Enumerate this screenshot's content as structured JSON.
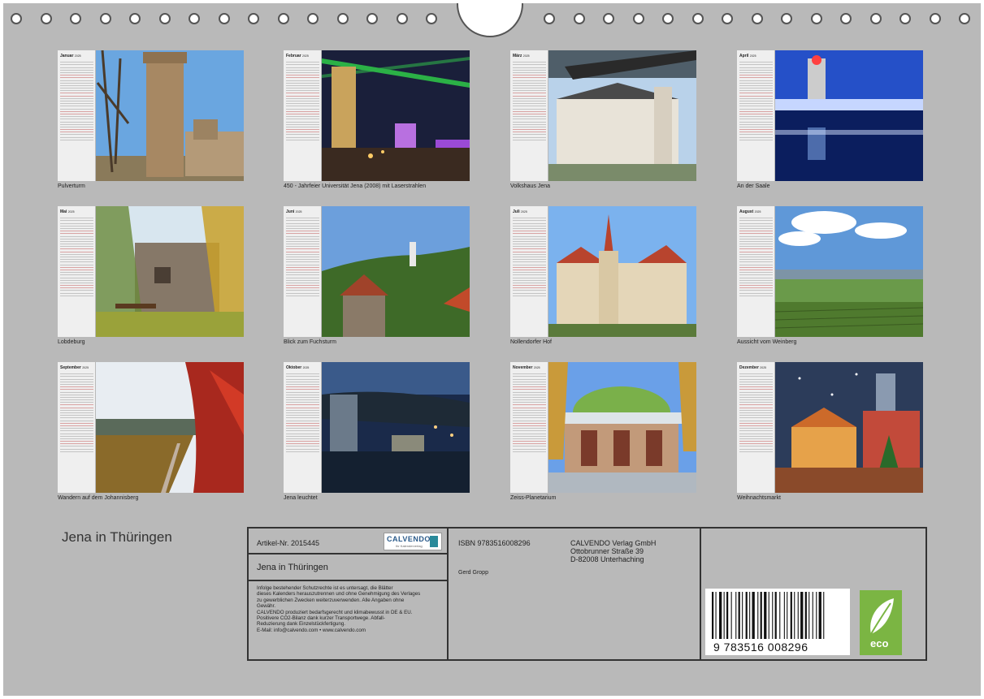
{
  "year": "2025",
  "months": [
    {
      "name": "Januar",
      "caption": "Pulverturm"
    },
    {
      "name": "Februar",
      "caption": "450 - Jahrfeier Universität Jena (2008) mit Laserstrahlen"
    },
    {
      "name": "März",
      "caption": "Volkshaus Jena"
    },
    {
      "name": "April",
      "caption": "An der Saale"
    },
    {
      "name": "Mai",
      "caption": "Lobdeburg"
    },
    {
      "name": "Juni",
      "caption": "Blick zum Fuchsturm"
    },
    {
      "name": "Juli",
      "caption": "Nollendorfer Hof"
    },
    {
      "name": "August",
      "caption": "Aussicht vom Weinberg"
    },
    {
      "name": "September",
      "caption": "Wandern auf dem Johannisberg"
    },
    {
      "name": "Oktober",
      "caption": "Jena leuchtet"
    },
    {
      "name": "November",
      "caption": "Zeiss-Planetarium"
    },
    {
      "name": "Dezember",
      "caption": "Weihnachtsmarkt"
    }
  ],
  "back_title": "Jena in Thüringen",
  "info": {
    "article": "Artikel-Nr. 2015445",
    "title": "Jena in Thüringen",
    "isbn": "ISBN 9783516008296",
    "publisher": [
      "CALVENDO Verlag GmbH",
      "Ottobrunner Straße 39",
      "D-82008 Unterhaching"
    ],
    "author": "Gerd Gropp",
    "legal": [
      "Infolge bestehender Schutzrechte ist es untersagt, die Blätter",
      "dieses Kalenders herauszutrennen und ohne Genehmigung des Verlages",
      "zu gewerblichen Zwecken weiterzuverwenden. Alle Angaben ohne",
      "Gewähr.",
      "CALVENDO produziert bedarfsgerecht und klimabewusst in DE & EU.",
      "Positivere CO2-Bilanz dank kurzer Transportwege. Abfall-",
      "Reduzierung dank Einzelstückfertigung.",
      "E-Mail: info@calvendo.com • www.calvendo.com"
    ],
    "logo_text": "CALVENDO",
    "logo_sub": "Ihr Kalenderverlag",
    "barcode_number": "9  783516  008296",
    "eco_label": "eco"
  }
}
